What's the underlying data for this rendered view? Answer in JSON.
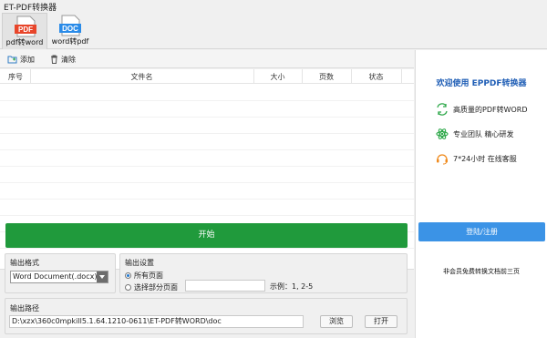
{
  "window": {
    "title": "ET-PDF转换器"
  },
  "tabs": [
    {
      "icon_text": "PDF",
      "label": "pdf转word",
      "icon_color": "#e8452a",
      "active": true
    },
    {
      "icon_text": "DOC",
      "label": "word转pdf",
      "icon_color": "#2a8be8",
      "active": false
    }
  ],
  "toolbar": {
    "add_label": "添加",
    "delete_label": "清除"
  },
  "table": {
    "columns": [
      "序号",
      "文件名",
      "大小",
      "页数",
      "状态"
    ]
  },
  "start_button": {
    "label": "开始",
    "color": "#209a3c"
  },
  "output_format": {
    "title": "输出格式",
    "selected": "Word Document(.docx)"
  },
  "output_settings": {
    "title": "输出设置",
    "option_all": "所有页面",
    "option_partial": "选择部分页面",
    "selected": "all",
    "page_range_value": "",
    "example": "示例：1, 2-5"
  },
  "output_path": {
    "title": "输出路径",
    "value": "D:\\xzx\\360c0mpkill5.1.64.1210-0611\\ET-PDF转WORD\\doc",
    "browse_label": "浏览",
    "open_label": "打开"
  },
  "sidebar": {
    "title": "欢迎使用 EPPDF转换器",
    "features": [
      {
        "icon": "convert-icon",
        "text": "高质量的PDF转WORD"
      },
      {
        "icon": "atom-icon",
        "text": "专业团队 精心研发"
      },
      {
        "icon": "headset-icon",
        "text": "7*24小时 在线客服"
      }
    ],
    "login_label": "登陆/注册",
    "member_note": "非会员免费转换文档前三页",
    "accent": "#3b93e6",
    "icon_color": "#2ea84a"
  }
}
